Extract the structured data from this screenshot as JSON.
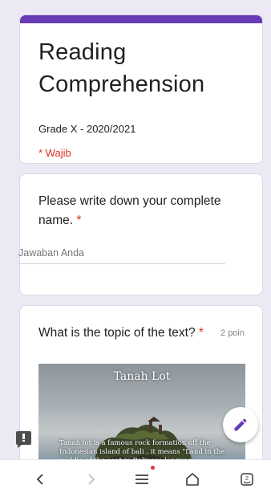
{
  "form": {
    "title": "Reading Comprehension",
    "description": "Grade X - 2020/2021",
    "required_note": "* Wajib",
    "accent_color": "#673ab7"
  },
  "questions": [
    {
      "title": "Please write down your complete name.",
      "required_mark": "*",
      "answer_placeholder": "Jawaban Anda"
    },
    {
      "title": "What is the topic of the text?",
      "required_mark": "*",
      "points": "2 poin",
      "image": {
        "title": "Tanah Lot",
        "caption": "Tanah lot is a famous rock formation off the Indonesian island of bali . it means \"Land in the middle of the sea\" in Balinese language."
      }
    }
  ],
  "fab": {
    "icon": "pencil-icon"
  },
  "feedback": {
    "icon": "feedback-icon"
  },
  "nav": {
    "back_icon": "back-chevron-icon",
    "forward_icon": "forward-chevron-icon",
    "menu_icon": "menu-icon",
    "home_icon": "home-icon",
    "tabs_icon": "tabs-icon",
    "tabs_count": "2",
    "notification_color": "#e53935"
  }
}
